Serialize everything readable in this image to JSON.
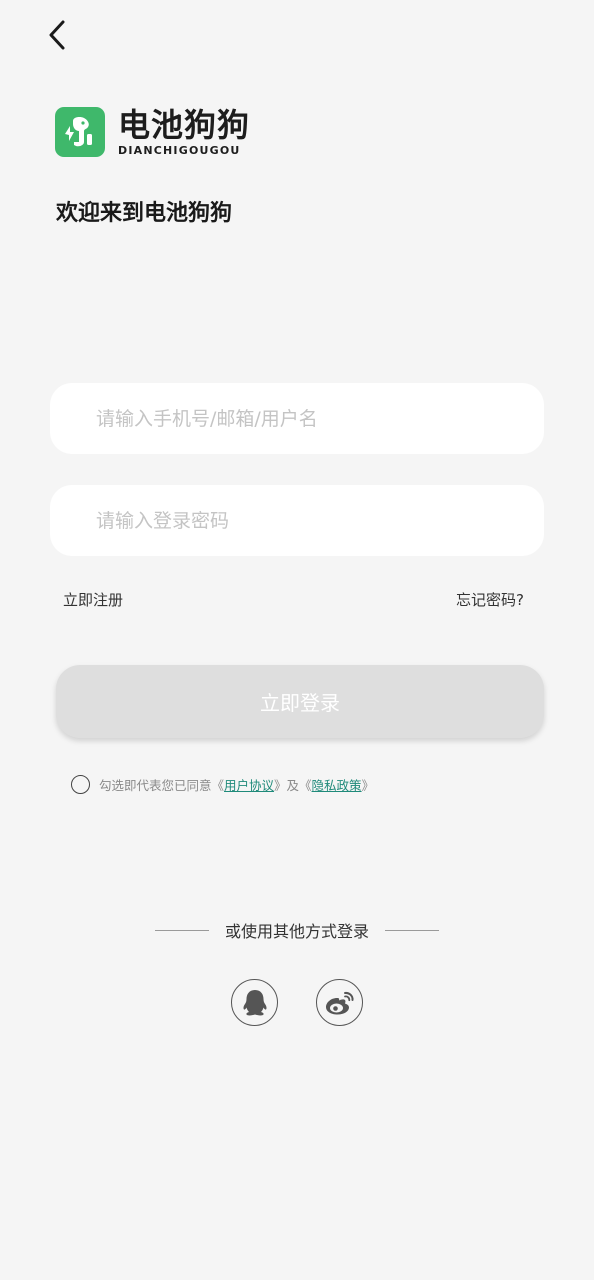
{
  "nav": {
    "back_icon": "chevron-left-icon"
  },
  "brand": {
    "name_cn": "电池狗狗",
    "name_en": "DIANCHIGOUGOU",
    "color": "#3fb86b"
  },
  "welcome": "欢迎来到电池狗狗",
  "form": {
    "username_placeholder": "请输入手机号/邮箱/用户名",
    "password_placeholder": "请输入登录密码"
  },
  "links": {
    "register": "立即注册",
    "forgot": "忘记密码?"
  },
  "login_button": "立即登录",
  "agreement": {
    "prefix": "勾选即代表您已同意《",
    "user_agreement": "用户协议",
    "middle": "》及《",
    "privacy_policy": "隐私政策",
    "suffix": "》",
    "link_color": "#1f8a7a"
  },
  "social": {
    "divider_text": "或使用其他方式登录",
    "providers": [
      "qq-icon",
      "weibo-icon"
    ]
  }
}
